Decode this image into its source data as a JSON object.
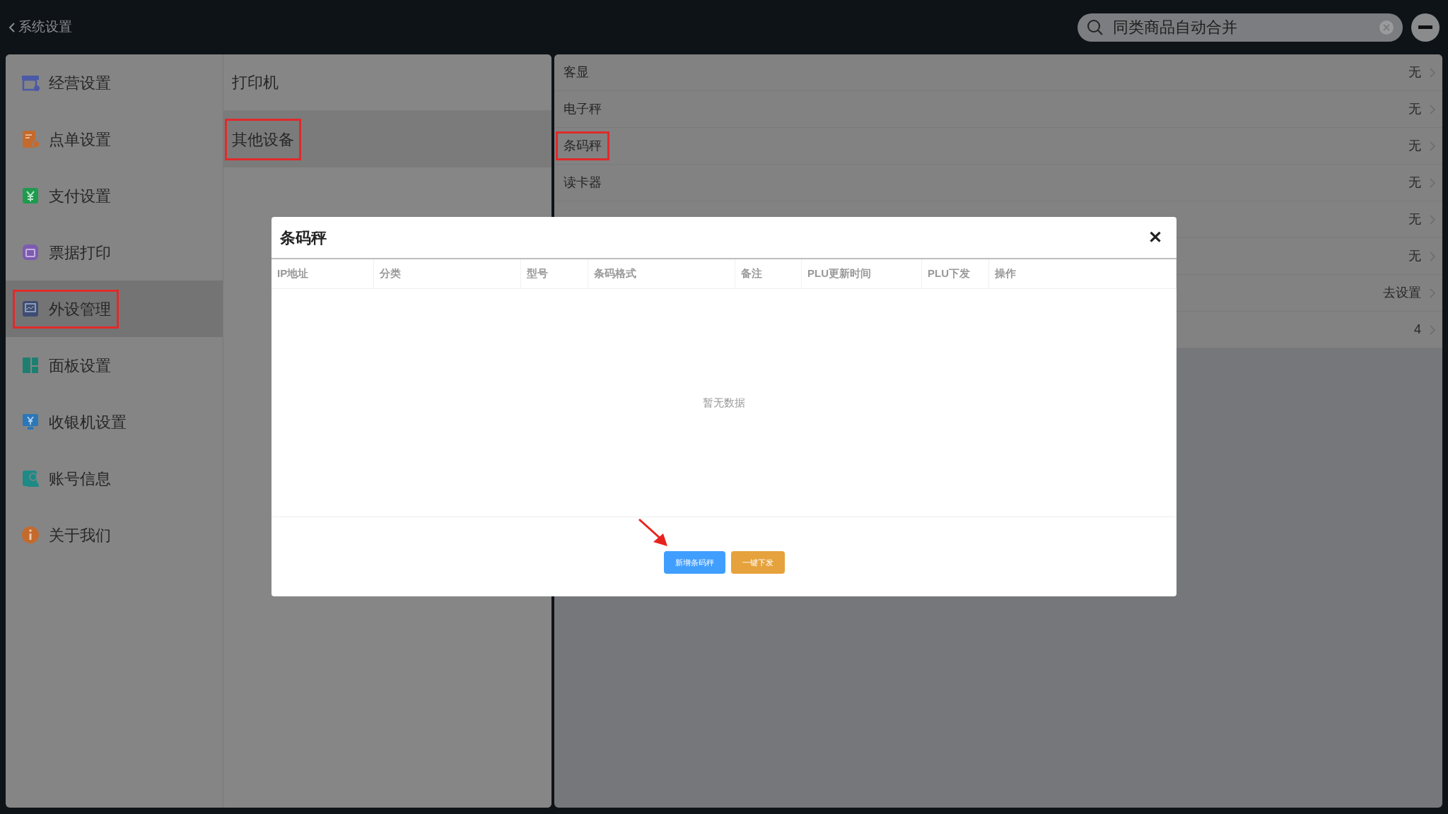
{
  "top_bar": {
    "back_label": "系统设置",
    "search": {
      "value": "同类商品自动合并"
    }
  },
  "sidebar": {
    "items": [
      {
        "label": "经营设置",
        "selected": false,
        "highlighted": false
      },
      {
        "label": "点单设置",
        "selected": false,
        "highlighted": false
      },
      {
        "label": "支付设置",
        "selected": false,
        "highlighted": false
      },
      {
        "label": "票据打印",
        "selected": false,
        "highlighted": false
      },
      {
        "label": "外设管理",
        "selected": true,
        "highlighted": true
      },
      {
        "label": "面板设置",
        "selected": false,
        "highlighted": false
      },
      {
        "label": "收银机设置",
        "selected": false,
        "highlighted": false
      },
      {
        "label": "账号信息",
        "selected": false,
        "highlighted": false
      },
      {
        "label": "关于我们",
        "selected": false,
        "highlighted": false
      }
    ]
  },
  "categories": [
    {
      "label": "打印机",
      "selected": false,
      "highlighted": false
    },
    {
      "label": "其他设备",
      "selected": true,
      "highlighted": true
    }
  ],
  "devices": [
    {
      "label": "客显",
      "value": "无",
      "highlighted": false
    },
    {
      "label": "电子秤",
      "value": "无",
      "highlighted": false
    },
    {
      "label": "条码秤",
      "value": "无",
      "highlighted": true
    },
    {
      "label": "读卡器",
      "value": "无",
      "highlighted": false
    },
    {
      "value": "无"
    },
    {
      "value": "无"
    },
    {
      "value": "去设置"
    },
    {
      "value": "4"
    }
  ],
  "dialog": {
    "title": "条码秤",
    "close": "✕",
    "columns": [
      "IP地址",
      "分类",
      "型号",
      "条码格式",
      "备注",
      "PLU更新时间",
      "PLU下发",
      "操作"
    ],
    "empty_text": "暂无数据",
    "buttons": [
      {
        "label": "新增条码秤",
        "kind": "primary"
      },
      {
        "label": "一键下发",
        "kind": "warning"
      }
    ]
  }
}
